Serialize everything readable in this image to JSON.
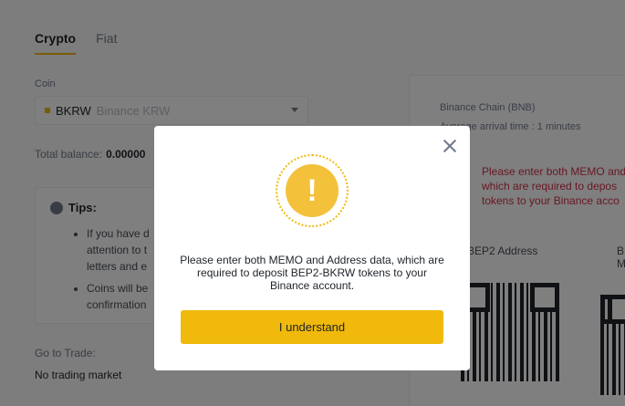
{
  "tabs": [
    {
      "label": "Crypto",
      "active": true
    },
    {
      "label": "Fiat",
      "active": false
    }
  ],
  "coin": {
    "label": "Coin",
    "code": "BKRW",
    "name": "Binance KRW"
  },
  "balance": {
    "label": "Total balance:",
    "value": "0.00000"
  },
  "tips": {
    "title": "Tips:",
    "items": [
      "If you have d",
      "attention to t",
      "letters and e",
      "Coins will be",
      "confirmation"
    ]
  },
  "goto": {
    "label": "Go to Trade:",
    "value": "No trading market"
  },
  "deposit_panel": {
    "chain": "Binance Chain (BNB)",
    "arrival": "Average arrival time : 1 minutes",
    "warning_lines": [
      "Please enter both MEMO and",
      "which are required to depos",
      "tokens to your Binance acco"
    ],
    "address_label": "BEP2 Address",
    "memo_label_lines": [
      "B",
      "M"
    ]
  },
  "modal": {
    "icon": "exclamation-icon",
    "message": "Please enter both MEMO and Address data, which are required to deposit BEP2-BKRW tokens to your Binance account.",
    "button_label": "I understand"
  },
  "colors": {
    "accent": "#f0b90b",
    "warning": "#cf304a"
  }
}
